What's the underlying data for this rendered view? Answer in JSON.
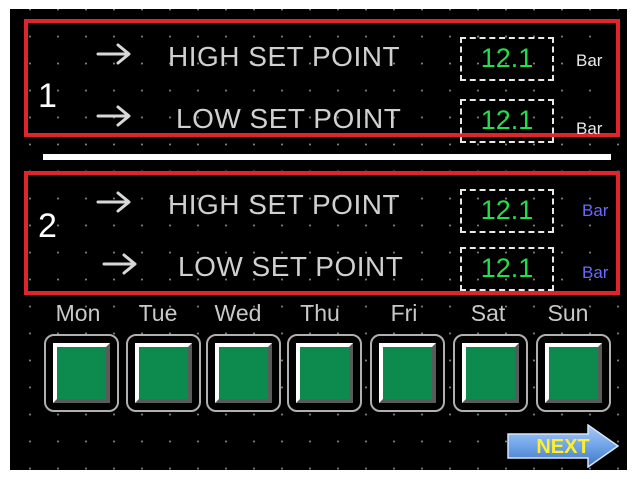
{
  "colors": {
    "frame": "#e0242c",
    "value_text": "#22e04a",
    "unit_group1": "#e8e8e8",
    "unit_group2": "#6a6aff",
    "day_button_fill": "#0d8a4e",
    "next_arrow": "#6fa4e8",
    "next_text": "#ffef2a"
  },
  "groups": [
    {
      "number": "1",
      "rows": [
        {
          "icon": "right-arrow-icon",
          "label": "HIGH SET POINT",
          "value": "12.1",
          "unit": "Bar"
        },
        {
          "icon": "right-arrow-icon",
          "label": "LOW SET POINT",
          "value": "12.1",
          "unit": "Bar"
        }
      ]
    },
    {
      "number": "2",
      "rows": [
        {
          "icon": "right-arrow-icon",
          "label": "HIGH SET POINT",
          "value": "12.1",
          "unit": "Bar"
        },
        {
          "icon": "right-arrow-icon",
          "label": "LOW SET POINT",
          "value": "12.1",
          "unit": "Bar"
        }
      ]
    }
  ],
  "days": [
    "Mon",
    "Tue",
    "Wed",
    "Thu",
    "Fri",
    "Sat",
    "Sun"
  ],
  "next_button": {
    "label": "NEXT",
    "icon": "right-arrow-icon"
  }
}
